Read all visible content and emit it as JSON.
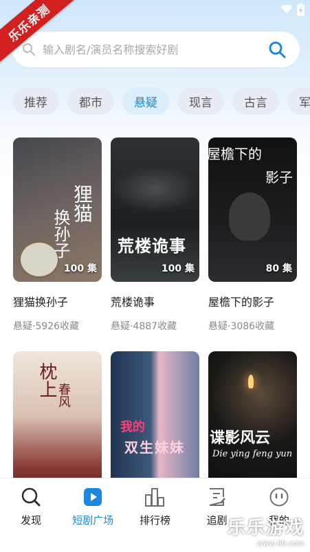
{
  "ribbon": {
    "text": "乐乐亲测"
  },
  "status": {
    "wifi_icon": "wifi-icon",
    "battery_icon": "battery-charging-icon"
  },
  "search": {
    "placeholder": "输入剧名/演员名称搜索好剧",
    "value": ""
  },
  "tabs": [
    {
      "label": "推荐",
      "active": false
    },
    {
      "label": "都市",
      "active": false
    },
    {
      "label": "悬疑",
      "active": true
    },
    {
      "label": "现言",
      "active": false
    },
    {
      "label": "古言",
      "active": false
    },
    {
      "label": "军",
      "active": false
    }
  ],
  "dramas": [
    {
      "title": "狸猫换孙子",
      "meta": "悬疑·5926收藏",
      "episodes": "100 集",
      "cover_text": [
        "狸猫",
        "换孙子"
      ],
      "palette": [
        "#3a3a42",
        "#7a6a60"
      ]
    },
    {
      "title": "荒楼诡事",
      "meta": "悬疑·4887收藏",
      "episodes": "100 集",
      "cover_text": [
        "荒楼诡事"
      ],
      "palette": [
        "#1e2224",
        "#3d4246"
      ]
    },
    {
      "title": "屋檐下的影子",
      "meta": "悬疑·3086收藏",
      "episodes": "80 集",
      "cover_text": [
        "屋檐下的",
        "影子"
      ],
      "palette": [
        "#0e0e10",
        "#2a2a2e"
      ]
    },
    {
      "title": "",
      "meta": "",
      "episodes": "",
      "cover_text": [
        "枕上",
        "春风"
      ],
      "palette": [
        "#e9dcd2",
        "#7a2a2a"
      ]
    },
    {
      "title": "",
      "meta": "",
      "episodes": "",
      "cover_text": [
        "我的",
        "双生妹妹"
      ],
      "palette": [
        "#2c3e5a",
        "#d86a8a"
      ]
    },
    {
      "title": "",
      "meta": "",
      "episodes": "",
      "cover_text": [
        "谍影风云",
        "Die ying feng yun"
      ],
      "palette": [
        "#121214",
        "#35302c"
      ]
    }
  ],
  "nav": [
    {
      "label": "发现",
      "icon": "discover-icon",
      "active": false
    },
    {
      "label": "短剧广场",
      "icon": "play-square-icon",
      "active": true
    },
    {
      "label": "排行榜",
      "icon": "ranking-icon",
      "active": false
    },
    {
      "label": "追剧",
      "icon": "follow-list-icon",
      "active": false
    },
    {
      "label": "我的",
      "icon": "profile-icon",
      "active": false
    }
  ],
  "watermark": {
    "brand": "乐乐游戏",
    "url": "www.6ll.com"
  },
  "colors": {
    "accent": "#1a87e0",
    "ribbon": "#d21f1f"
  }
}
